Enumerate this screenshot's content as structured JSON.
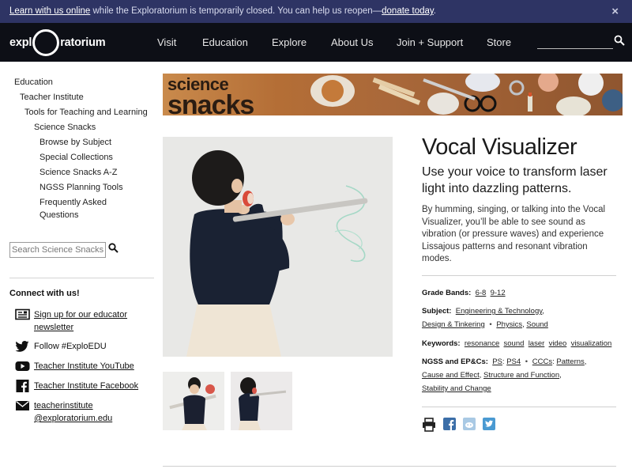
{
  "announcement": {
    "link1": "Learn with us online",
    "middle": " while the Exploratorium is temporarily closed. You can help us reopen—",
    "link2": "donate today",
    "end": ".",
    "close": "×"
  },
  "nav": {
    "logo_left": "expl",
    "logo_right": "ratorium",
    "items": [
      "Visit",
      "Education",
      "Explore",
      "About Us",
      "Join + Support",
      "Store"
    ],
    "search_value": ""
  },
  "sidebar": {
    "breadcrumbs": [
      "Education",
      "Teacher Institute",
      "Tools for Teaching and Learning",
      "Science Snacks"
    ],
    "subitems": [
      "Browse by Subject",
      "Special Collections",
      "Science Snacks A-Z",
      "NGSS Planning Tools",
      "Frequently Asked",
      "Questions"
    ],
    "search_placeholder": "Search Science Snacks",
    "connect_title": "Connect with us!",
    "social": [
      {
        "icon": "newsletter-icon",
        "line1": "Sign up for our educator",
        "line2": "newsletter"
      },
      {
        "icon": "twitter-icon",
        "line1": "Follow #ExploEDU",
        "line2": ""
      },
      {
        "icon": "youtube-icon",
        "line1": "Teacher Institute YouTube",
        "line2": ""
      },
      {
        "icon": "facebook-icon",
        "line1": "Teacher Institute Facebook",
        "line2": ""
      },
      {
        "icon": "email-icon",
        "line1": "teacherinstitute",
        "line2": "@exploratorium.edu"
      }
    ]
  },
  "banner": {
    "line1": "science",
    "line2": "snacks"
  },
  "snack": {
    "title": "Vocal Visualizer",
    "subtitle": "Use your voice to transform laser light into dazzling patterns.",
    "description": "By humming, singing, or talking into the Vocal Visualizer, you’ll be able to see sound as vibration (or pressure waves) and experience Lissajous patterns and resonant vibration modes."
  },
  "meta": {
    "grade_label": "Grade Bands:",
    "grades": [
      "6-8",
      "9-12"
    ],
    "subject_label": "Subject:",
    "subjects": [
      "Engineering & Technology",
      "Design & Tinkering",
      "Physics",
      "Sound"
    ],
    "keywords_label": "Keywords:",
    "keywords": [
      "resonance",
      "sound",
      "laser",
      "video",
      "visualization"
    ],
    "ngss_label": "NGSS and EP&Cs:",
    "ngss_ps": "PS",
    "ngss_ps4": "PS4",
    "ngss_cccs": "CCCs",
    "ngss_items": [
      "Patterns",
      "Cause and Effect",
      "Structure and Function",
      "Stability and Change"
    ]
  },
  "share_icons": [
    "print-icon",
    "facebook-share-icon",
    "reddit-share-icon",
    "twitter-share-icon"
  ],
  "colors": {
    "announce_bg": "#2e3464",
    "nav_bg": "#0d0f16",
    "share_blue": "#3b7fb8"
  }
}
